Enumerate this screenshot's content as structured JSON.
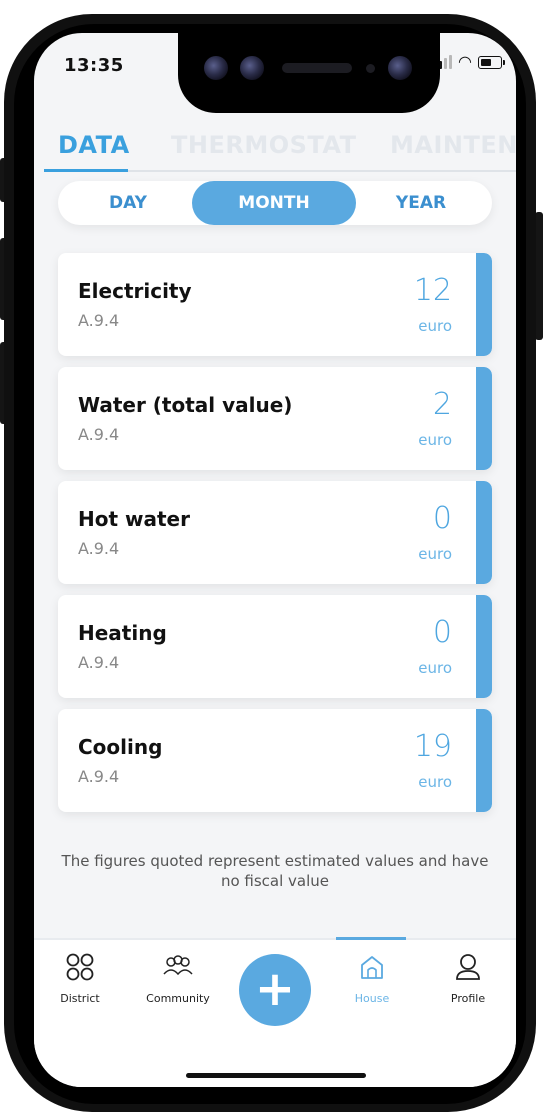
{
  "status_bar": {
    "time": "13:35"
  },
  "tabs": [
    {
      "label": "DATA",
      "active": true
    },
    {
      "label": "THERMOSTAT",
      "active": false
    },
    {
      "label": "MAINTEN",
      "active": false
    }
  ],
  "period_selector": {
    "options": [
      "DAY",
      "MONTH",
      "YEAR"
    ],
    "selected": "MONTH"
  },
  "cards": [
    {
      "title": "Electricity",
      "code": "A.9.4",
      "value": "12",
      "unit": "euro"
    },
    {
      "title": "Water (total value)",
      "code": "A.9.4",
      "value": "2",
      "unit": "euro"
    },
    {
      "title": "Hot water",
      "code": "A.9.4",
      "value": "0",
      "unit": "euro"
    },
    {
      "title": "Heating",
      "code": "A.9.4",
      "value": "0",
      "unit": "euro"
    },
    {
      "title": "Cooling",
      "code": "A.9.4",
      "value": "19",
      "unit": "euro"
    }
  ],
  "disclaimer": "The figures quoted represent estimated values and have no fiscal value",
  "bottom_nav": {
    "items": [
      {
        "label": "District",
        "icon": "grid-circles-icon"
      },
      {
        "label": "Community",
        "icon": "people-group-icon"
      },
      {
        "label": "House",
        "icon": "house-icon",
        "active": true
      },
      {
        "label": "Profile",
        "icon": "user-icon"
      }
    ],
    "add_icon": "plus-icon"
  },
  "colors": {
    "accent": "#5aa9e0",
    "tab_active": "#3aa0de",
    "value_text": "#4ea6e0"
  }
}
